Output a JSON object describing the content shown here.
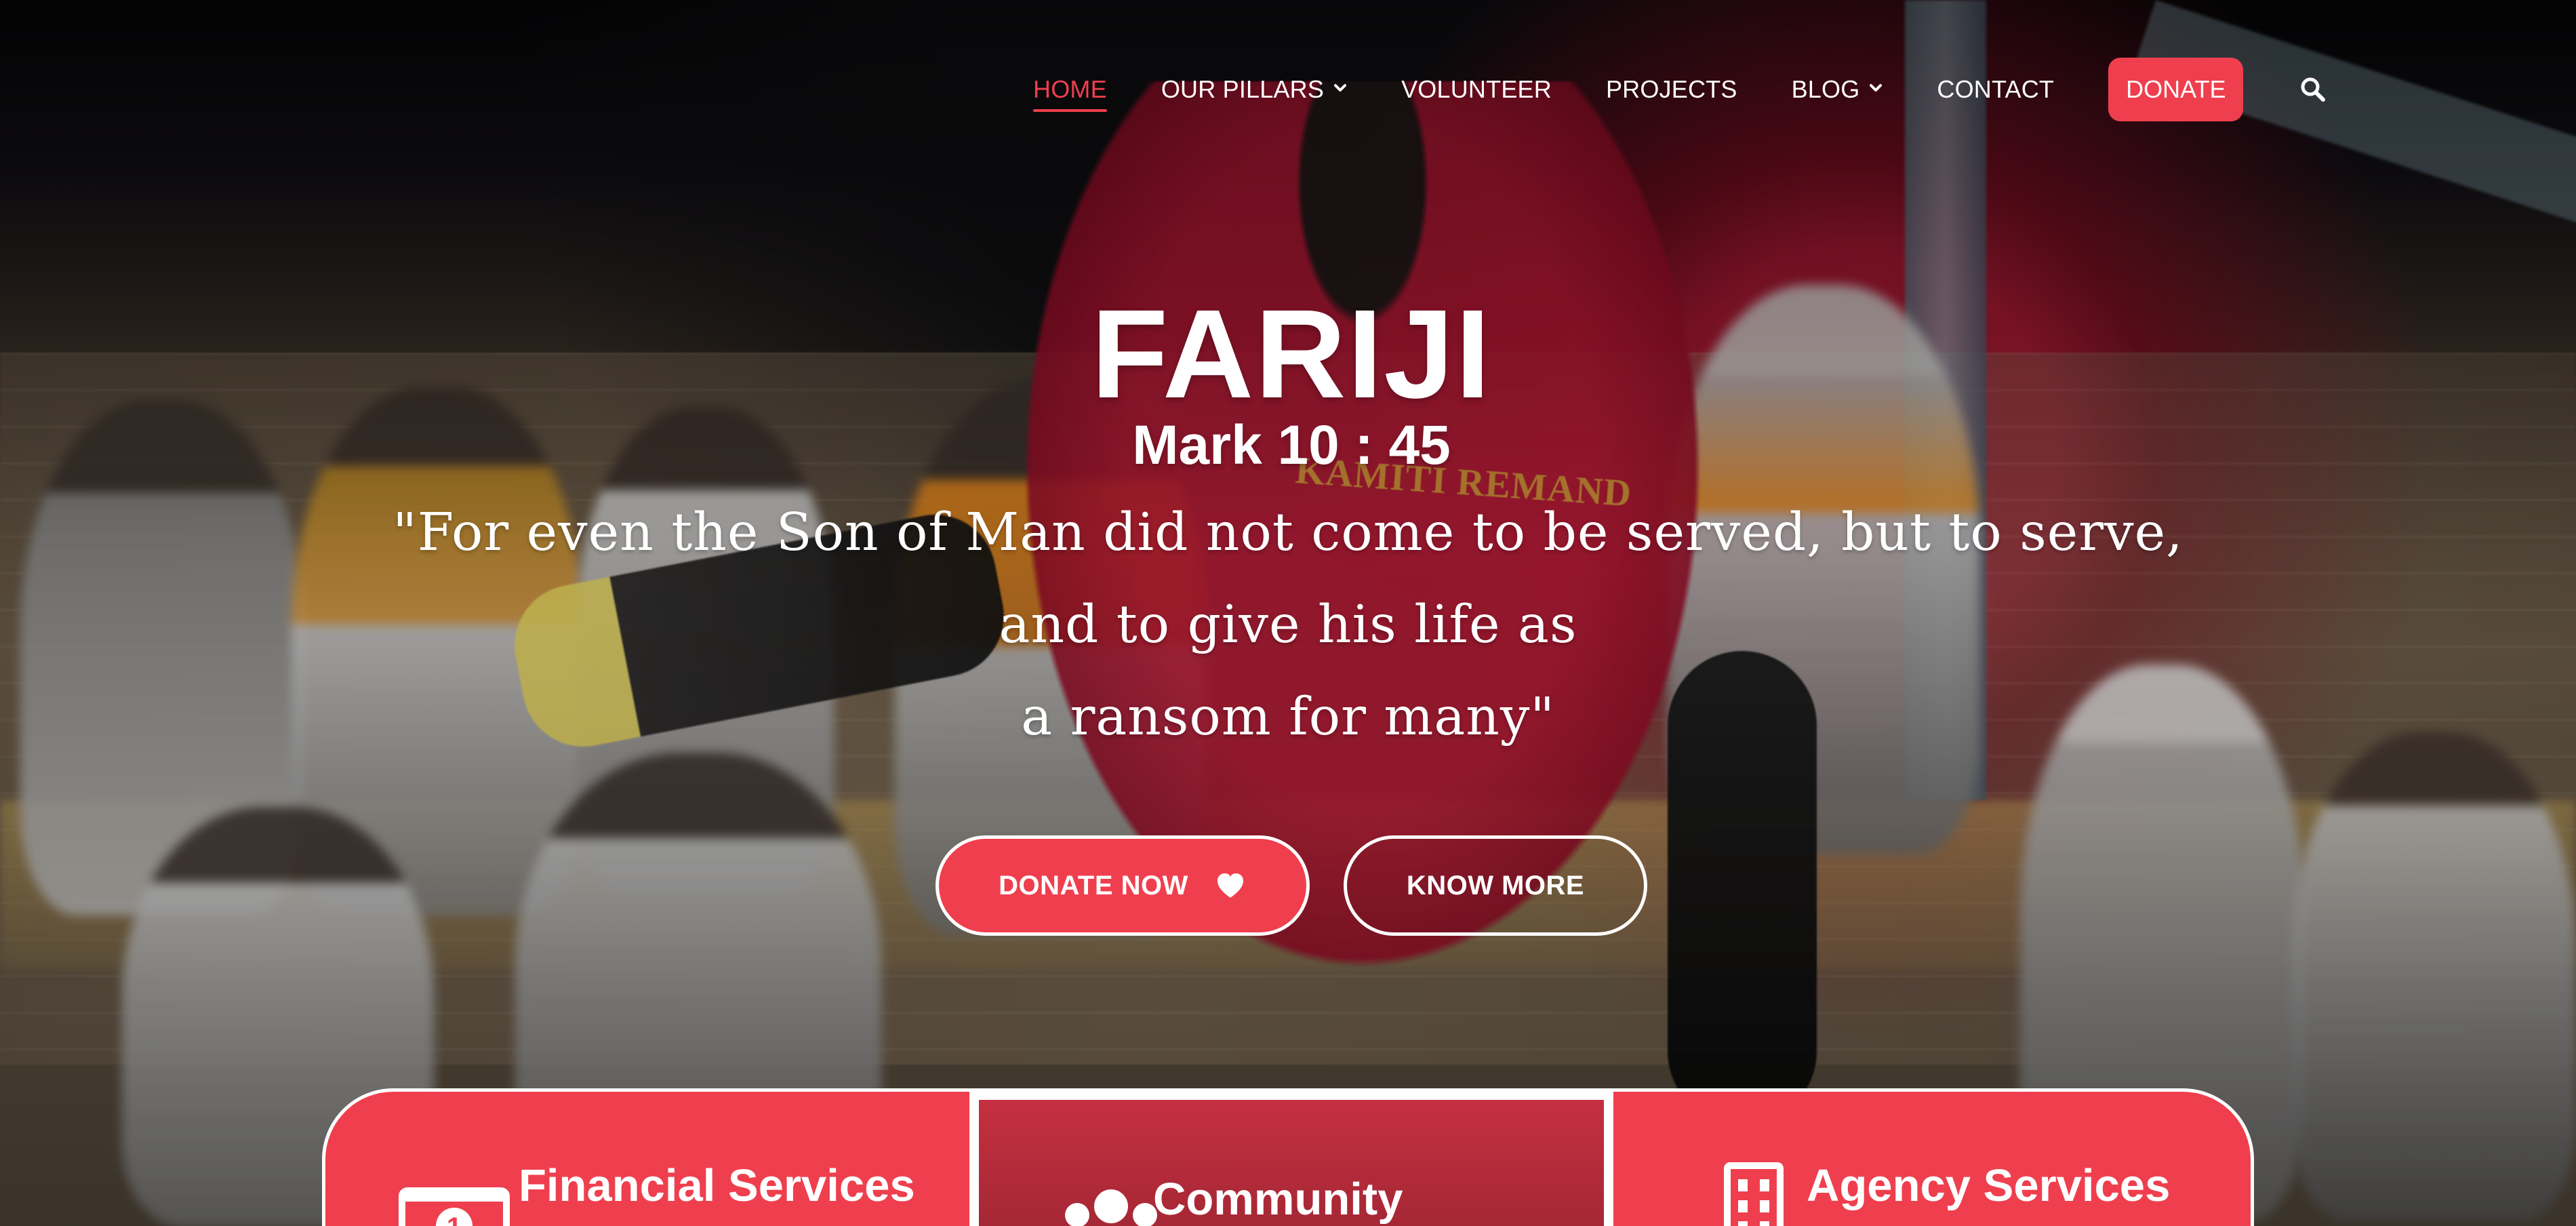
{
  "nav": {
    "items": [
      {
        "label": "HOME",
        "active": true,
        "has_dropdown": false
      },
      {
        "label": "OUR PILLARS",
        "active": false,
        "has_dropdown": true
      },
      {
        "label": "VOLUNTEER",
        "active": false,
        "has_dropdown": false
      },
      {
        "label": "PROJECTS",
        "active": false,
        "has_dropdown": false
      },
      {
        "label": "BLOG",
        "active": false,
        "has_dropdown": true
      },
      {
        "label": "CONTACT",
        "active": false,
        "has_dropdown": false
      }
    ],
    "donate_label": "DONATE",
    "search_icon": "search-icon"
  },
  "hero": {
    "title": "FARIJI",
    "verse_ref": "Mark 10 : 45",
    "quote_line_1": "\"For even the Son of Man did not come to be served, but to serve, and to give his life as",
    "quote_line_2": "a ransom for many\"",
    "background_text": "KAMITI REMAND",
    "buttons": {
      "donate_now": "DONATE NOW",
      "know_more": "KNOW MORE"
    }
  },
  "services": [
    {
      "label": "Financial Services",
      "icon": "money-icon"
    },
    {
      "label": "Community",
      "icon": "community-icon"
    },
    {
      "label": "Agency Services",
      "icon": "building-icon"
    }
  ],
  "colors": {
    "accent": "#ef3f4e",
    "text": "#ffffff",
    "active_nav": "#f03f4d"
  }
}
